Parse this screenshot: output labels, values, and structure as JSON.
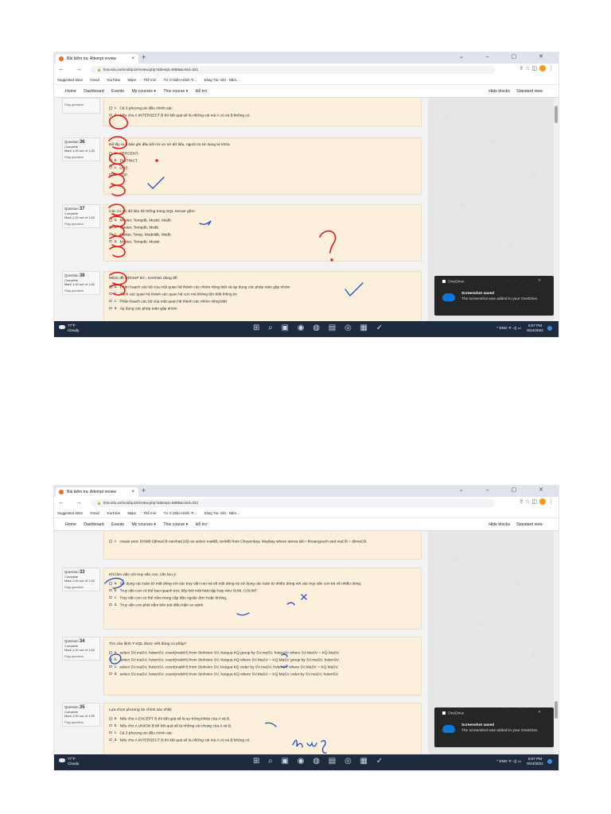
{
  "browser": {
    "tab_title": "Bài kiểm tra: Attempt review",
    "new_tab": "+",
    "tab_close": "×",
    "window_controls": "⌄ – ▢ ✕",
    "nav_buttons": "← → ↻",
    "url_lock": "🔒",
    "url": "lms.edu.vn/mod/quiz/review.php?attempt=6885&cmid=321",
    "right_icons": "⇪ ☆ ◫",
    "menu": "⋮",
    "bookmarks": [
      "Suggested Sites",
      "Gmail",
      "YouTube",
      "Maps",
      "Thế mới",
      "Tư Vì Diện Hành Tr...",
      "Sáng Tác Việt - Năm..."
    ]
  },
  "site_nav": {
    "items": [
      "Home",
      "Dashboard",
      "Events",
      "My courses ▾",
      "This course ▾",
      "Hỗ trợ"
    ],
    "hide_blocks": "Hide blocks",
    "standard_view": "Standard view"
  },
  "notification": {
    "app": "OneDrive",
    "controls": "··· ✕",
    "title": "Screenshot saved",
    "body": "The screenshot was added to your OneDrive."
  },
  "taskbar": {
    "temp": "77°F",
    "condition": "Cloudy",
    "apps": "⊞ ⌕ ▣ ◉ ◍ ▤ ◎ ▦ ✓",
    "tray": "^ ENG ᯤ ◁) ▭",
    "time": "6:07 PM",
    "date": "9/24/2022"
  },
  "shot1": {
    "top_partial": {
      "flag": "Flag question",
      "options": [
        {
          "letter": "c.",
          "text": "Cả 3 phương án đều chính xác"
        },
        {
          "letter": "d.",
          "text": "Nếu cho A INTERSECT B thì kết quả sẽ là những cái mà A có và B không có."
        }
      ]
    },
    "questions": [
      {
        "label": "Question",
        "number": "36",
        "status": "Complete",
        "mark": "Mark 1.00 out of 1.00",
        "flag": "Flag question",
        "text": "Để lấy ra n bản ghi đầu tiên từ cơ sở dữ liệu, người ta sử dụng từ khóa",
        "options": [
          {
            "letter": "a.",
            "text": "PERCENT."
          },
          {
            "letter": "b.",
            "text": "DISTINCT."
          },
          {
            "letter": "c.",
            "text": "LIKE."
          },
          {
            "letter": "d.",
            "text": "TOP."
          }
        ]
      },
      {
        "label": "Question",
        "number": "37",
        "status": "Complete",
        "mark": "Mark 1.00 out of 1.00",
        "flag": "Flag question",
        "text": "Các cơ sở dữ liệu hệ thống trong SQL Server gồm:",
        "options": [
          {
            "letter": "a.",
            "text": "Master, Tempdb, Model, Msdb."
          },
          {
            "letter": "b.",
            "text": "Master, Tempdb, Msdb."
          },
          {
            "letter": "c.",
            "text": "Master, Temp, Modeldb, Msdb."
          },
          {
            "letter": "d.",
            "text": "Master, Tempdb, Model."
          }
        ]
      },
      {
        "label": "Question",
        "number": "38",
        "status": "Complete",
        "mark": "Mark 1.00 out of 1.00",
        "flag": "Flag question",
        "text": "Mệnh đề GROUP BY...HAVING dùng để:",
        "options": [
          {
            "letter": "a.",
            "text": "Phân hoạch các bộ của một quan hệ thành các nhóm riêng biệt và áp dụng các phép toán gộp nhóm"
          },
          {
            "letter": "b.",
            "text": "Tách các quan hệ thành các quan hệ con mà không tổn thất thông tin"
          },
          {
            "letter": "c.",
            "text": "Phân hoạch các bộ của một quan hệ thành các nhóm riêng biệt"
          },
          {
            "letter": "d.",
            "text": "Áp dụng các phép toán gộp nhóm"
          }
        ]
      }
    ]
  },
  "shot2": {
    "top_partial": {
      "options": [
        {
          "letter": "c.",
          "text": "create proc DSMB (@maCB varchar(10)) as select maMB, tenMB from Chuyenbay, Maybay where tamxa &lt;= khoangcach and maCB = @maCB."
        }
      ]
    },
    "questions": [
      {
        "label": "Question",
        "number": "33",
        "status": "Complete",
        "mark": "Mark 1.00 out of 1.00",
        "flag": "Flag question",
        "text": "Khi làm việc với truy vấn con, cần lưu ý:",
        "options": [
          {
            "letter": "a.",
            "text": "Sử dụng các toán tử một dòng với các truy vấn con trả về một dòng và sử dụng các toán tử nhiều dòng với các truy vấn con trả về nhiều dòng."
          },
          {
            "letter": "b.",
            "text": "Truy vấn con có thể bao quanh trực tiếp bởi một hàm tập hợp như SUM, COUNT."
          },
          {
            "letter": "c.",
            "text": "Truy vấn con có thể nằm trong cặp dấu ngoặc đơn hoặc không."
          },
          {
            "letter": "d.",
            "text": "Truy vấn con phải nằm bên trái điều kiện so sánh."
          }
        ]
      },
      {
        "label": "Question",
        "number": "34",
        "status": "Complete",
        "mark": "Mark 1.00 out of 1.00",
        "flag": "Flag question",
        "text": "Tìm câu lệnh T-SQL được viết đúng cú pháp?",
        "options": [
          {
            "letter": "a.",
            "text": "select SV.maSV, hotenSV, count(maMH) from Sinhvien SV, Ketqua KQ group by SV.maSV, hotenSV where SV.MaSV = KQ.MaSV."
          },
          {
            "letter": "b.",
            "text": "select SV.maSV, hotenSV, count(maMH) from Sinhvien SV, Ketqua KQ where SV.MaSV = KQ.MaSV group by SV.maSV, hotenSV."
          },
          {
            "letter": "c.",
            "text": "select SV.maSV, hotenSV, count(maMH) from Sinhvien SV, Ketqua KQ order by SV.maSV, hotenSV where SV.MaSV = KQ.MaSV."
          },
          {
            "letter": "d.",
            "text": "select SV.maSV, hotenSV, count(maMH) from Sinhvien SV, Ketqua KQ where SV.MaSV = KQ.MaSV order by SV.maSV, hotenSV."
          }
        ]
      },
      {
        "label": "Question",
        "number": "35",
        "status": "Complete",
        "mark": "Mark 1.00 out of 1.00",
        "flag": "Flag question",
        "text": "Lựa chọn phương án chính xác nhất:",
        "options": [
          {
            "letter": "a.",
            "text": "Nếu cho A EXCEPT B thì kết quả sẽ là sự trùng khớp của A và B."
          },
          {
            "letter": "b.",
            "text": "Nếu cho A UNION B thì kết quả sẽ là những cái chung của A và B."
          },
          {
            "letter": "c.",
            "text": "Cả 3 phương án đều chính xác"
          },
          {
            "letter": "d.",
            "text": "Nếu cho A INTERSECT B thì kết quả sẽ là những cái mà A có và B không có."
          }
        ]
      }
    ]
  },
  "colors": {
    "answer_box": "#fcefdc",
    "drawer": "#e6e6e6",
    "taskbar": "#1e2a3e",
    "red_ink": "#e0201b",
    "blue_ink": "#1a4fc4"
  }
}
